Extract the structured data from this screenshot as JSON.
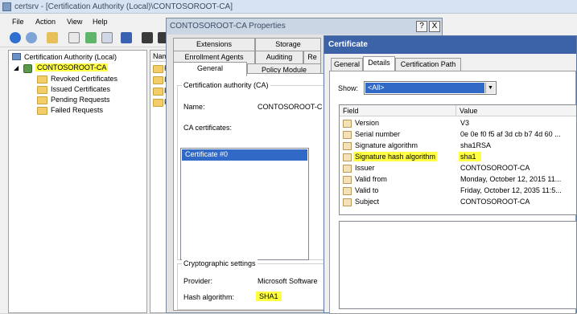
{
  "certsrv": {
    "title": "certsrv - [Certification Authority (Local)\\CONTOSOROOT-CA]",
    "menu": [
      "File",
      "Action",
      "View",
      "Help"
    ],
    "tree": {
      "root": "Certification Authority (Local)",
      "ca": "CONTOSOROOT-CA",
      "children": [
        "Revoked Certificates",
        "Issued Certificates",
        "Pending Requests",
        "Failed Requests"
      ]
    },
    "list_header": "Nam",
    "list_items": [
      "R",
      "Is",
      "P",
      "F"
    ]
  },
  "props": {
    "title": "CONTOSOROOT-CA Properties",
    "help_btn": "?",
    "close_btn": "X",
    "tabs_row1": [
      "Extensions",
      "Storage"
    ],
    "tabs_row2": [
      "Enrollment Agents",
      "Auditing",
      "Re"
    ],
    "tabs_row3": [
      "General",
      "Policy Module"
    ],
    "ca_group": "Certification authority (CA)",
    "name_label": "Name:",
    "name_value": "CONTOSOROOT-C",
    "ca_certs_label": "CA certificates:",
    "ca_cert_item": "Certificate #0",
    "crypto_group": "Cryptographic settings",
    "provider_label": "Provider:",
    "provider_value": "Microsoft Software",
    "hash_label": "Hash algorithm:",
    "hash_value": "SHA1"
  },
  "cert": {
    "title": "Certificate",
    "tabs": [
      "General",
      "Details",
      "Certification Path"
    ],
    "show_label": "Show:",
    "show_value": "<All>",
    "col_field": "Field",
    "col_value": "Value",
    "rows": [
      {
        "field": "Version",
        "value": "V3"
      },
      {
        "field": "Serial number",
        "value": "0e 0e f0 f5 af 3d cb b7 4d 60 ..."
      },
      {
        "field": "Signature algorithm",
        "value": "sha1RSA"
      },
      {
        "field": "Signature hash algorithm",
        "value": "sha1"
      },
      {
        "field": "Issuer",
        "value": "CONTOSOROOT-CA"
      },
      {
        "field": "Valid from",
        "value": "Monday, October 12, 2015 11..."
      },
      {
        "field": "Valid to",
        "value": "Friday, October 12, 2035 11:5..."
      },
      {
        "field": "Subject",
        "value": "CONTOSOROOT-CA"
      }
    ]
  },
  "colors": {
    "highlight": "#ffff44",
    "selection": "#3169c6",
    "cert_title": "#3c63a8"
  }
}
